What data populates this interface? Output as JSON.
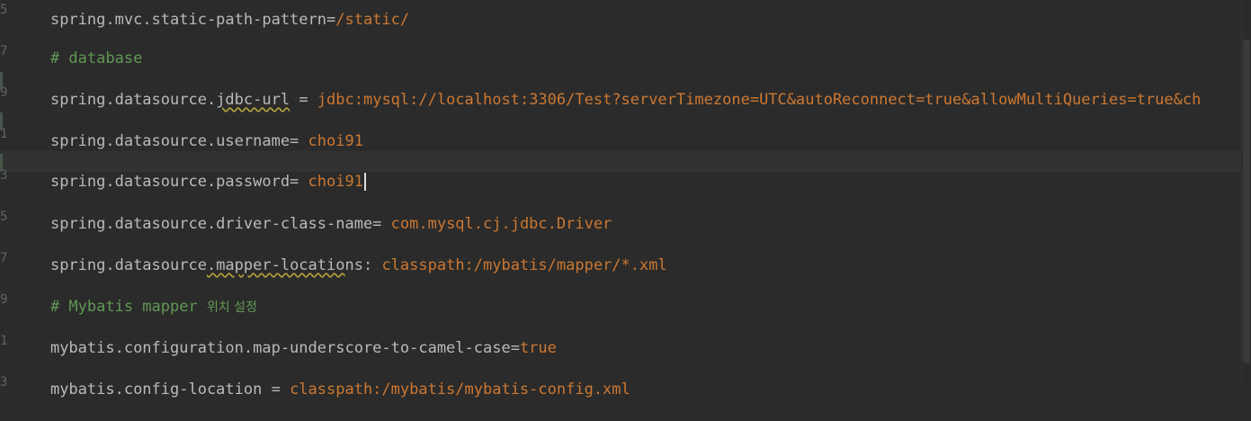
{
  "editor": {
    "lines": [
      {
        "key": "spring.mvc.static-path-pattern=",
        "value": "/static/"
      },
      {
        "comment": "# database"
      },
      {
        "key_pre": "spring.datasource.",
        "key_squig": "jdbc-url",
        "key_post": " = ",
        "value": "jdbc:mysql://localhost:3306/Test?serverTimezone=UTC&autoReconnect=true&allowMultiQueries=true&ch"
      },
      {
        "key": "spring.datasource.username=",
        "value": " choi91"
      },
      {
        "key": "spring.datasource.password=",
        "value": " choi91"
      },
      {
        "key": "spring.datasource.driver-class-name=",
        "value": " com.mysql.cj.jdbc.Driver"
      },
      {
        "key_pre": "spring.datasource",
        "key_squig": ".mapper-locatio",
        "key_post": "ns: ",
        "value": "classpath:/mybatis/mapper/*.xml"
      },
      {
        "comment": "# Mybatis mapper ",
        "comment_kor": "위치 설정"
      },
      {
        "key": "mybatis.configuration.map-underscore-to-camel-case=",
        "value": "true"
      },
      {
        "key": "mybatis.config-location = ",
        "value": "classpath:/mybatis/mybatis-config.xml"
      }
    ]
  },
  "colors": {
    "background": "#2b2b2b",
    "key": "#bababa",
    "value": "#cc7832",
    "comment": "#629755"
  }
}
